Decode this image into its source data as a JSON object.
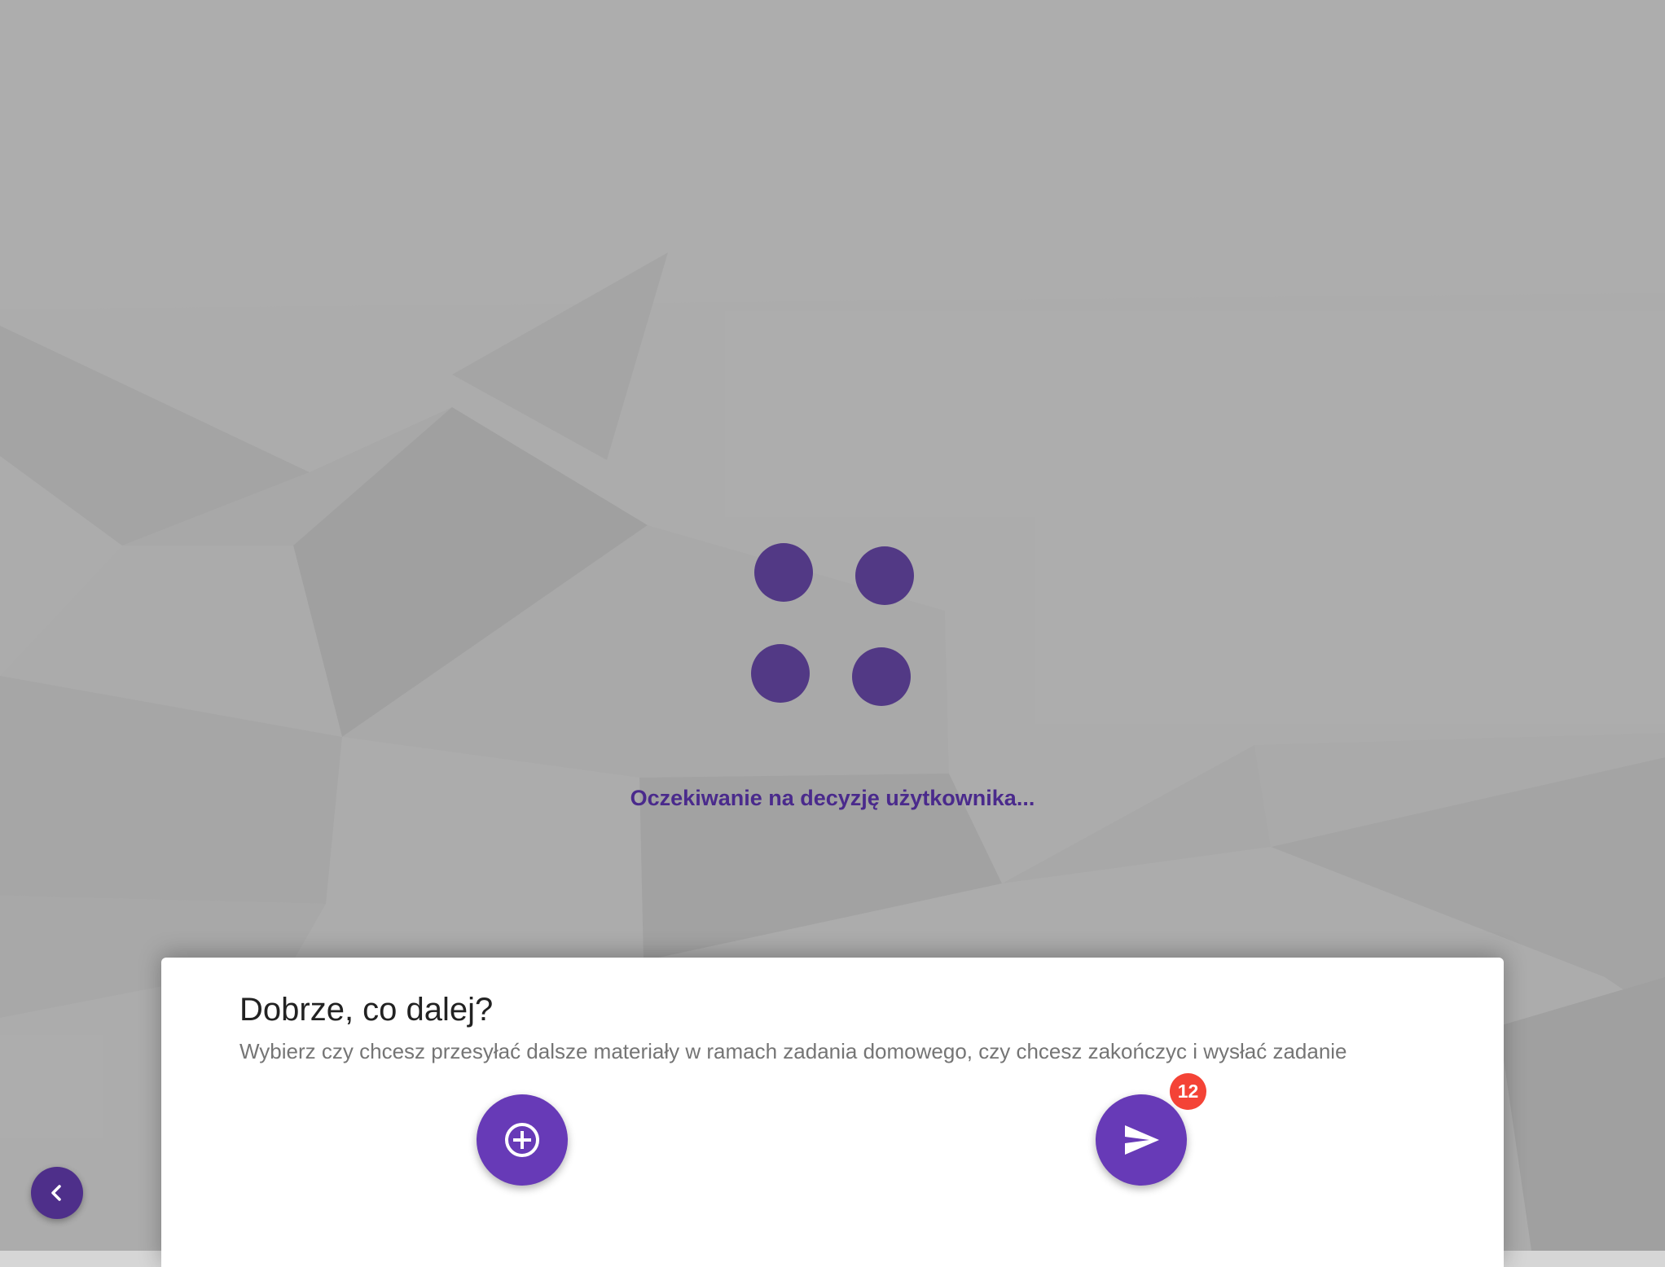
{
  "loader": {
    "status_text": "Oczekiwanie na decyzję użytkownika..."
  },
  "dialog": {
    "title": "Dobrze, co dalej?",
    "subtitle": "Wybierz czy chcesz przesyłać dalsze materiały w ramach zadania domowego, czy chcesz zakończyc i wysłać zadanie",
    "add_button": {
      "icon": "add-circle-icon"
    },
    "send_button": {
      "icon": "send-icon",
      "badge_count": "12"
    }
  },
  "navigation": {
    "back_button": {
      "icon": "chevron-left-icon"
    }
  },
  "colors": {
    "accent": "#673ab7",
    "loader_dot": "#523985",
    "status_text": "#4a2a8c",
    "badge": "#f44336",
    "back_button": "#4e2f8a"
  }
}
